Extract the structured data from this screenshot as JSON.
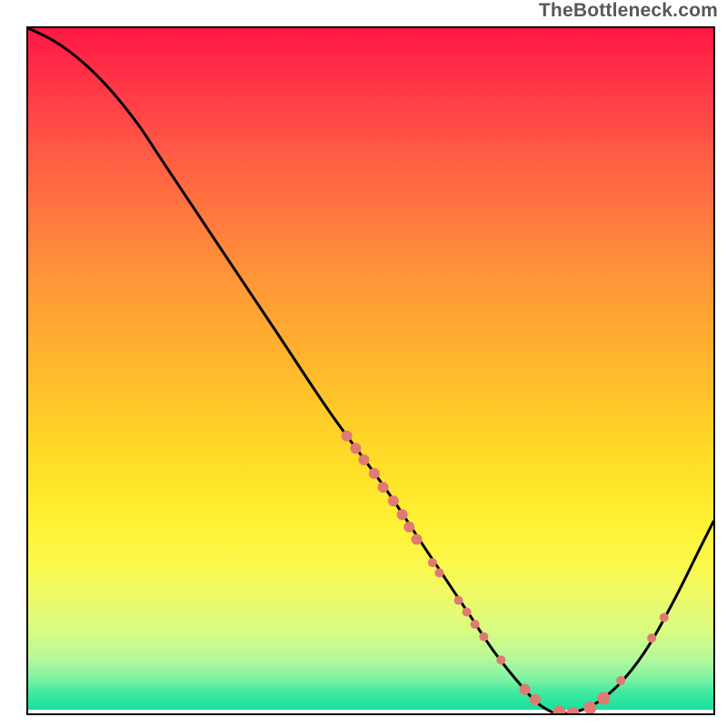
{
  "watermark": "TheBottleneck.com",
  "chart_data": {
    "type": "line",
    "title": "",
    "xlabel": "",
    "ylabel": "",
    "xlim": [
      0,
      100
    ],
    "ylim": [
      0,
      100
    ],
    "grid": false,
    "legend": false,
    "background": "rainbow-vertical-gradient",
    "series": [
      {
        "name": "bottleneck-curve",
        "stroke": "#000000",
        "x": [
          0,
          4,
          8,
          12,
          16,
          20,
          28,
          36,
          44,
          52,
          58,
          64,
          68,
          72,
          75,
          78,
          82,
          86,
          90,
          94,
          98,
          100
        ],
        "y": [
          100,
          98,
          95,
          91,
          86,
          80,
          68,
          56,
          44,
          33,
          24,
          15,
          9,
          4,
          1,
          0,
          1,
          4,
          9,
          16,
          24,
          28
        ]
      }
    ],
    "markers": {
      "name": "highlight-dots",
      "color": "#e07a72",
      "points": [
        {
          "x": 46.5,
          "y": 40.5,
          "r": 6
        },
        {
          "x": 47.8,
          "y": 38.7,
          "r": 6
        },
        {
          "x": 49.0,
          "y": 37.0,
          "r": 6
        },
        {
          "x": 50.5,
          "y": 35.0,
          "r": 6
        },
        {
          "x": 51.8,
          "y": 33.0,
          "r": 6
        },
        {
          "x": 53.3,
          "y": 31.0,
          "r": 6
        },
        {
          "x": 54.6,
          "y": 29.0,
          "r": 6
        },
        {
          "x": 55.6,
          "y": 27.2,
          "r": 6
        },
        {
          "x": 56.7,
          "y": 25.4,
          "r": 6
        },
        {
          "x": 59.0,
          "y": 22.0,
          "r": 5
        },
        {
          "x": 60.0,
          "y": 20.5,
          "r": 5
        },
        {
          "x": 62.8,
          "y": 16.5,
          "r": 5
        },
        {
          "x": 64.0,
          "y": 14.8,
          "r": 5
        },
        {
          "x": 65.2,
          "y": 13.0,
          "r": 5
        },
        {
          "x": 66.5,
          "y": 11.2,
          "r": 5
        },
        {
          "x": 69.0,
          "y": 7.8,
          "r": 5
        },
        {
          "x": 72.5,
          "y": 3.5,
          "r": 6
        },
        {
          "x": 74.0,
          "y": 2.0,
          "r": 6
        },
        {
          "x": 77.5,
          "y": 0.2,
          "r": 7
        },
        {
          "x": 79.5,
          "y": 0.0,
          "r": 7
        },
        {
          "x": 82.0,
          "y": 0.8,
          "r": 7
        },
        {
          "x": 84.0,
          "y": 2.2,
          "r": 7
        },
        {
          "x": 86.5,
          "y": 4.8,
          "r": 5
        },
        {
          "x": 91.0,
          "y": 11.0,
          "r": 5
        },
        {
          "x": 92.8,
          "y": 14.0,
          "r": 5
        }
      ]
    }
  }
}
